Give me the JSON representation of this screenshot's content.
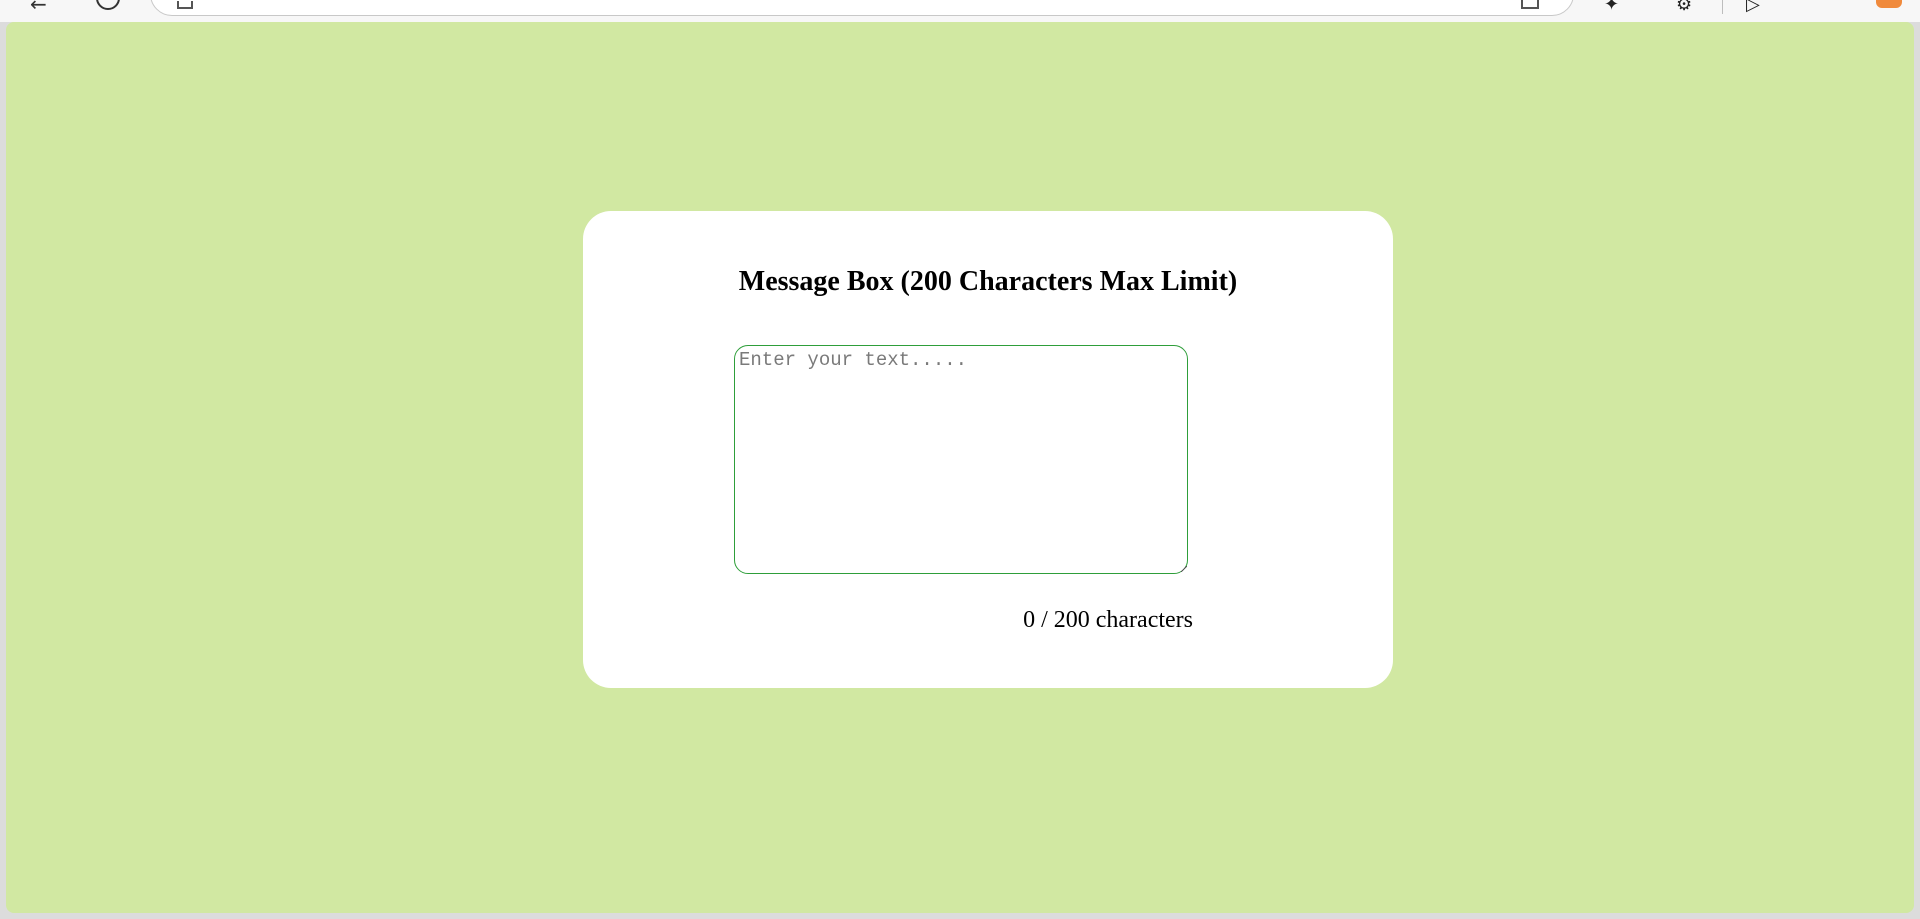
{
  "browser": {
    "back_icon": "back-arrow-icon",
    "info_icon": "info-icon",
    "lock_icon": "lock-icon",
    "bookmark_icon": "star-icon",
    "extension_icon": "puzzle-icon",
    "profile_icon": "profile-icon"
  },
  "page": {
    "background_color": "#d1e8a2",
    "card_color": "#ffffff",
    "border_color": "#2e9e3a"
  },
  "message_box": {
    "title": "Message Box (200 Characters Max Limit)",
    "placeholder": "Enter your text.....",
    "value": "",
    "counter": "0 / 200 characters"
  }
}
